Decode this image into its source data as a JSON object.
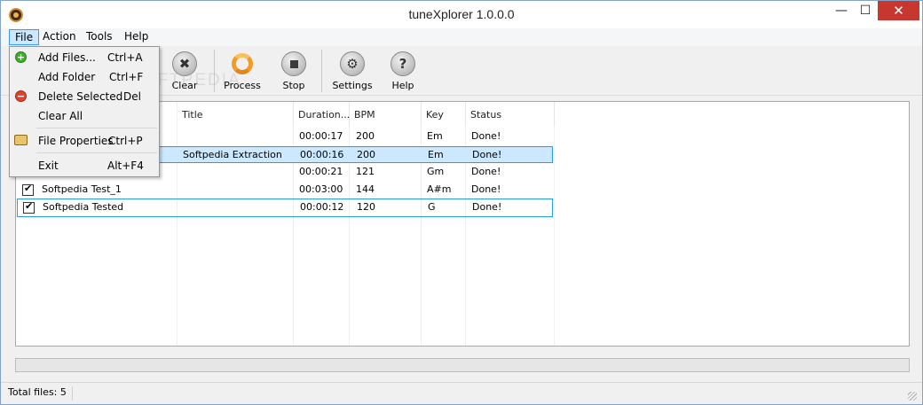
{
  "window": {
    "title": "tuneXplorer 1.0.0.0"
  },
  "menubar": {
    "items": [
      "File",
      "Action",
      "Tools",
      "Help"
    ]
  },
  "file_menu": {
    "items": [
      {
        "label": "Add Files...",
        "shortcut": "Ctrl+A",
        "icon": "add-icon"
      },
      {
        "label": "Add Folder",
        "shortcut": "Ctrl+F",
        "icon": ""
      },
      {
        "label": "Delete Selected",
        "shortcut": "Del",
        "icon": "delete-icon"
      },
      {
        "label": "Clear All",
        "shortcut": "",
        "icon": ""
      },
      {
        "label": "File Properties",
        "shortcut": "Ctrl+P",
        "icon": "properties-icon"
      },
      {
        "label": "Exit",
        "shortcut": "Alt+F4",
        "icon": ""
      }
    ]
  },
  "toolbar": {
    "clear": "Clear",
    "process": "Process",
    "stop": "Stop",
    "settings": "Settings",
    "help": "Help"
  },
  "table": {
    "columns": [
      "Title",
      "Duration...",
      "BPM",
      "Key",
      "Status"
    ],
    "rows": [
      {
        "file": "",
        "title": "",
        "duration": "00:00:17",
        "bpm": "200",
        "key": "Em",
        "status": "Done!"
      },
      {
        "file": "",
        "title": "Softpedia Extraction",
        "duration": "00:00:16",
        "bpm": "200",
        "key": "Em",
        "status": "Done!"
      },
      {
        "file": "",
        "title": "",
        "duration": "00:00:21",
        "bpm": "121",
        "key": "Gm",
        "status": "Done!"
      },
      {
        "file": "Softpedia Test_1",
        "title": "",
        "duration": "00:03:00",
        "bpm": "144",
        "key": "A#m",
        "status": "Done!"
      },
      {
        "file": "Softpedia Tested",
        "title": "",
        "duration": "00:00:12",
        "bpm": "120",
        "key": "G",
        "status": "Done!"
      }
    ]
  },
  "progress": {
    "value": 0
  },
  "status": {
    "text": "Total files: 5"
  },
  "watermark": "SOFTPEDIA",
  "colors": {
    "selection": "#cce8ff",
    "selection_border": "#26a0da",
    "close": "#c7372f"
  }
}
